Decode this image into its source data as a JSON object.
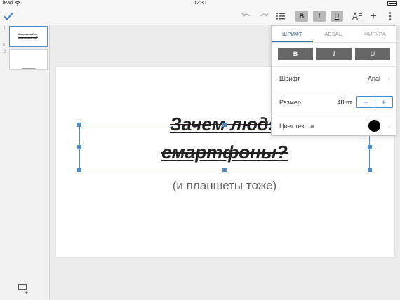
{
  "status": {
    "device": "iPad",
    "time": "12:30"
  },
  "toolbar": {
    "bold": "B",
    "italic": "I",
    "underline": "U",
    "plus": "+",
    "accent": "#3b7fd2"
  },
  "sidebar": {
    "slides": [
      {
        "number": "1",
        "title": "Зачем людям смартфоны?",
        "subtitle": "(и планшеты тоже)"
      },
      {
        "number": "2"
      }
    ],
    "delete_glyph": "×"
  },
  "slide": {
    "title_line1": "Зачем людя",
    "title_line2": "смартфоны?",
    "subtitle": "(и планшеты тоже)"
  },
  "popover": {
    "tabs": [
      "ШРИФТ",
      "АБЗАЦ",
      "ФИГУРА"
    ],
    "active_tab": "ШРИФТ",
    "buttons": {
      "bold": "B",
      "italic": "I",
      "underline": "U"
    },
    "font_label": "Шрифт",
    "font_value": "Arial",
    "size_label": "Размер",
    "size_value": "48 пт",
    "minus": "−",
    "plus": "+",
    "color_label": "Цвет текста",
    "text_color": "#000000"
  }
}
